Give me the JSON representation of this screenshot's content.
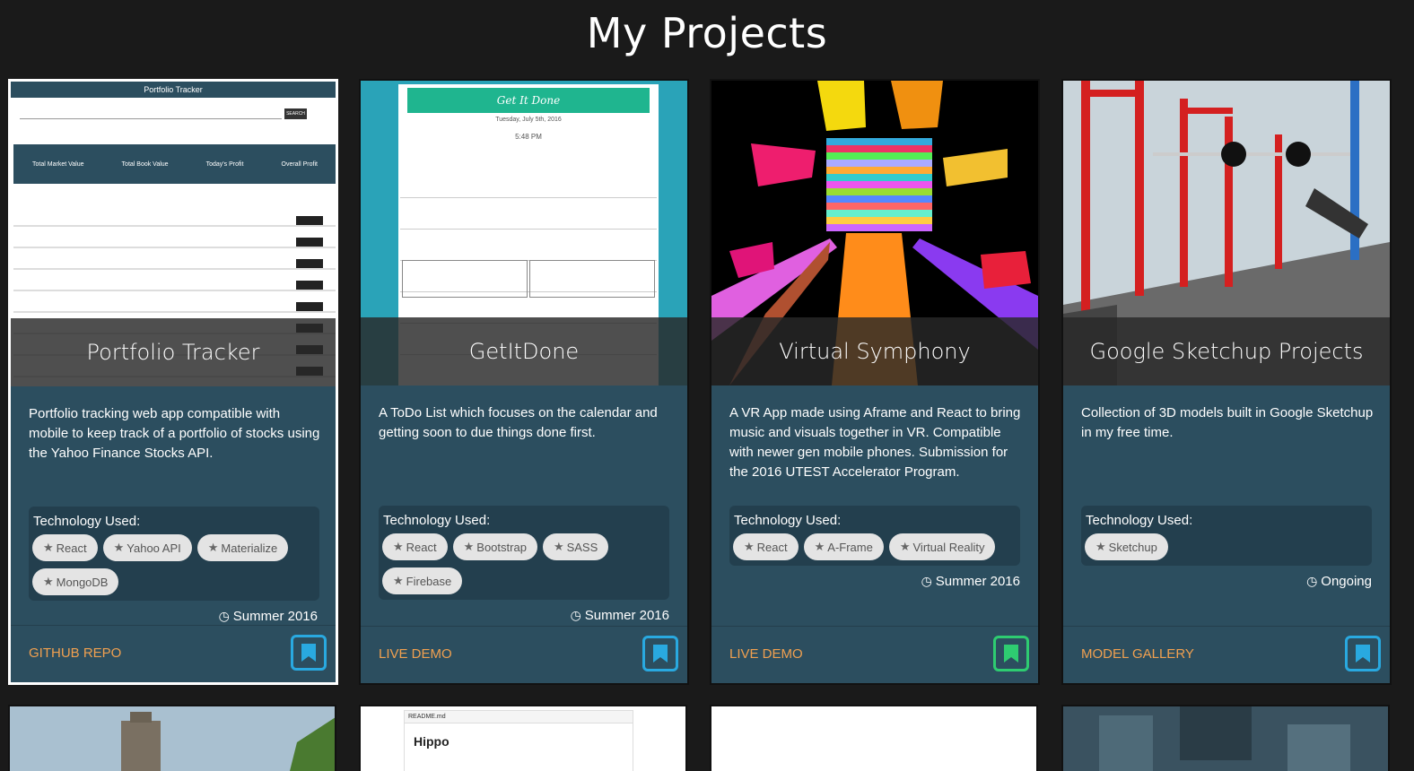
{
  "page": {
    "title": "My Projects"
  },
  "labels": {
    "tech_used": "Technology Used:"
  },
  "colors": {
    "background": "#1a1a1a",
    "card": "#2c4e5f",
    "link": "#f0a050",
    "bookmark_blue": "#29a9e0",
    "bookmark_green": "#2ecc71"
  },
  "projects": [
    {
      "title": "Portfolio Tracker",
      "description": "Portfolio tracking web app compatible with mobile to keep track of a portfolio of stocks using the Yahoo Finance Stocks API.",
      "tech": [
        "React",
        "Yahoo API",
        "Materialize",
        "MongoDB"
      ],
      "date": "Summer 2016",
      "link": "GITHUB REPO",
      "bookmark_color": "#29a9e0"
    },
    {
      "title": "GetItDone",
      "description": "A ToDo List which focuses on the calendar and getting soon to due things done first.",
      "tech": [
        "React",
        "Bootstrap",
        "SASS",
        "Firebase"
      ],
      "date": "Summer 2016",
      "link": "LIVE DEMO",
      "bookmark_color": "#29a9e0"
    },
    {
      "title": "Virtual Symphony",
      "description": "A VR App made using Aframe and React to bring music and visuals together in VR. Compatible with newer gen mobile phones. Submission for the 2016 UTEST Accelerator Program.",
      "tech": [
        "React",
        "A-Frame",
        "Virtual Reality"
      ],
      "date": "Summer 2016",
      "link": "LIVE DEMO",
      "bookmark_color": "#2ecc71"
    },
    {
      "title": "Google Sketchup Projects",
      "description": "Collection of 3D models built in Google Sketchup in my free time.",
      "tech": [
        "Sketchup"
      ],
      "date": "Ongoing",
      "link": "MODEL GALLERY",
      "bookmark_color": "#29a9e0"
    }
  ],
  "previews": {
    "portfolio": {
      "app_title": "Portfolio Tracker",
      "search_button": "SEARCH",
      "stats": [
        "Total Market Value",
        "Total Book Value",
        "Today's Profit",
        "Overall Profit"
      ]
    },
    "getitdone": {
      "app_title": "Get It Done",
      "date": "Tuesday, July 5th, 2016",
      "time": "5:48 PM"
    },
    "hippo": {
      "file": "README.md",
      "heading": "Hippo"
    }
  }
}
